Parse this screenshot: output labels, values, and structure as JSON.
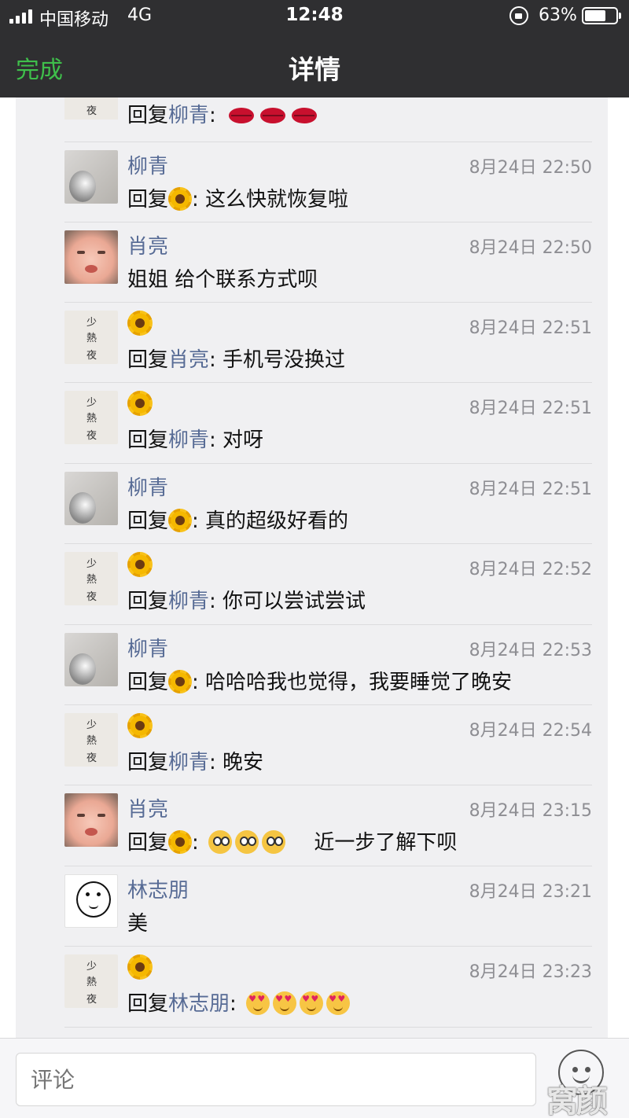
{
  "status_bar": {
    "carrier": "中国移动",
    "network": "4G",
    "time": "12:48",
    "battery": "63%",
    "battery_level": 0.63
  },
  "nav": {
    "done_label": "完成",
    "title": "详情"
  },
  "comments": [
    {
      "name": "柳青",
      "time": "8月24日 22:50",
      "prefix": "回复",
      "target_sunflower": true,
      "text": ": 这么快就恢复啦"
    },
    {
      "name": "肖亮",
      "time": "8月24日 22:50",
      "text": "姐姐  给个联系方式呗"
    },
    {
      "name_sunflower": true,
      "time": "8月24日 22:51",
      "prefix": "回复",
      "target": "肖亮",
      "text": ": 手机号没换过"
    },
    {
      "name_sunflower": true,
      "time": "8月24日 22:51",
      "prefix": "回复",
      "target": "柳青",
      "text": ": 对呀"
    },
    {
      "name": "柳青",
      "time": "8月24日 22:51",
      "prefix": "回复",
      "target_sunflower": true,
      "text": ": 真的超级好看的"
    },
    {
      "name_sunflower": true,
      "time": "8月24日 22:52",
      "prefix": "回复",
      "target": "柳青",
      "text": ": 你可以尝试尝试"
    },
    {
      "name": "柳青",
      "time": "8月24日 22:53",
      "prefix": "回复",
      "target_sunflower": true,
      "text": ": 哈哈哈我也觉得，我要睡觉了晚安"
    },
    {
      "name_sunflower": true,
      "time": "8月24日 22:54",
      "prefix": "回复",
      "target": "柳青",
      "text": ": 晚安"
    },
    {
      "name": "肖亮",
      "time": "8月24日 23:15",
      "prefix": "回复",
      "target_sunflower": true,
      "text": ":",
      "emoji": "flushed x3",
      "text2": "近一步了解下呗"
    },
    {
      "name": "林志朋",
      "time": "8月24日 23:21",
      "text": "美"
    },
    {
      "name_sunflower": true,
      "time": "8月24日 23:23",
      "prefix": "回复",
      "target": "林志朋",
      "text": ":",
      "emoji": "heart-eyes x4"
    }
  ],
  "top_partial": {
    "prefix": "回复",
    "target": "柳青",
    "text": ":",
    "emoji": "kiss-mark x3"
  },
  "avatar_night_text": [
    "少",
    "熱",
    "夜"
  ],
  "comment_bar": {
    "placeholder": "评论",
    "emoji_icon": "smiley-face-icon"
  },
  "watermark": "窝颜",
  "colors": {
    "nav_bg": "#2f2f31",
    "done_green": "#3fbf4b",
    "link_blue": "#576b95",
    "panel_bg": "#f0f0f2",
    "timestamp_gray": "#8e8e93"
  }
}
